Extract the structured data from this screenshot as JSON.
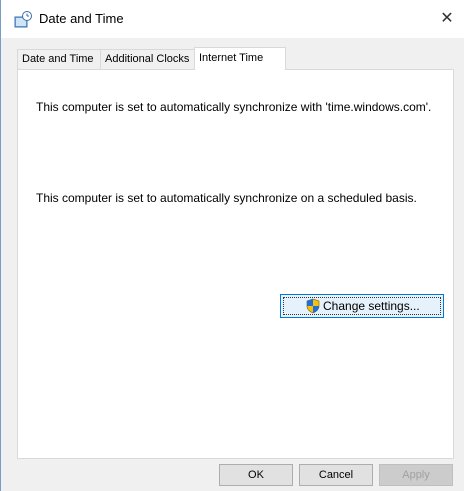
{
  "window": {
    "title": "Date and Time",
    "close_glyph": "✕"
  },
  "tabs": [
    {
      "label": "Date and Time",
      "active": false
    },
    {
      "label": "Additional Clocks",
      "active": false
    },
    {
      "label": "Internet Time",
      "active": true
    }
  ],
  "content": {
    "sync_server_text": "This computer is set to automatically synchronize with 'time.windows.com'.",
    "sync_schedule_text": "This computer is set to automatically synchronize on a scheduled basis.",
    "change_settings_label": "Change settings..."
  },
  "buttons": {
    "ok": "OK",
    "cancel": "Cancel",
    "apply": "Apply"
  },
  "icons": {
    "title": "date-time-icon",
    "shield": "uac-shield-icon"
  },
  "colors": {
    "accent": "#0078d7",
    "window_bg": "#f0f0f0",
    "panel_bg": "#ffffff"
  }
}
